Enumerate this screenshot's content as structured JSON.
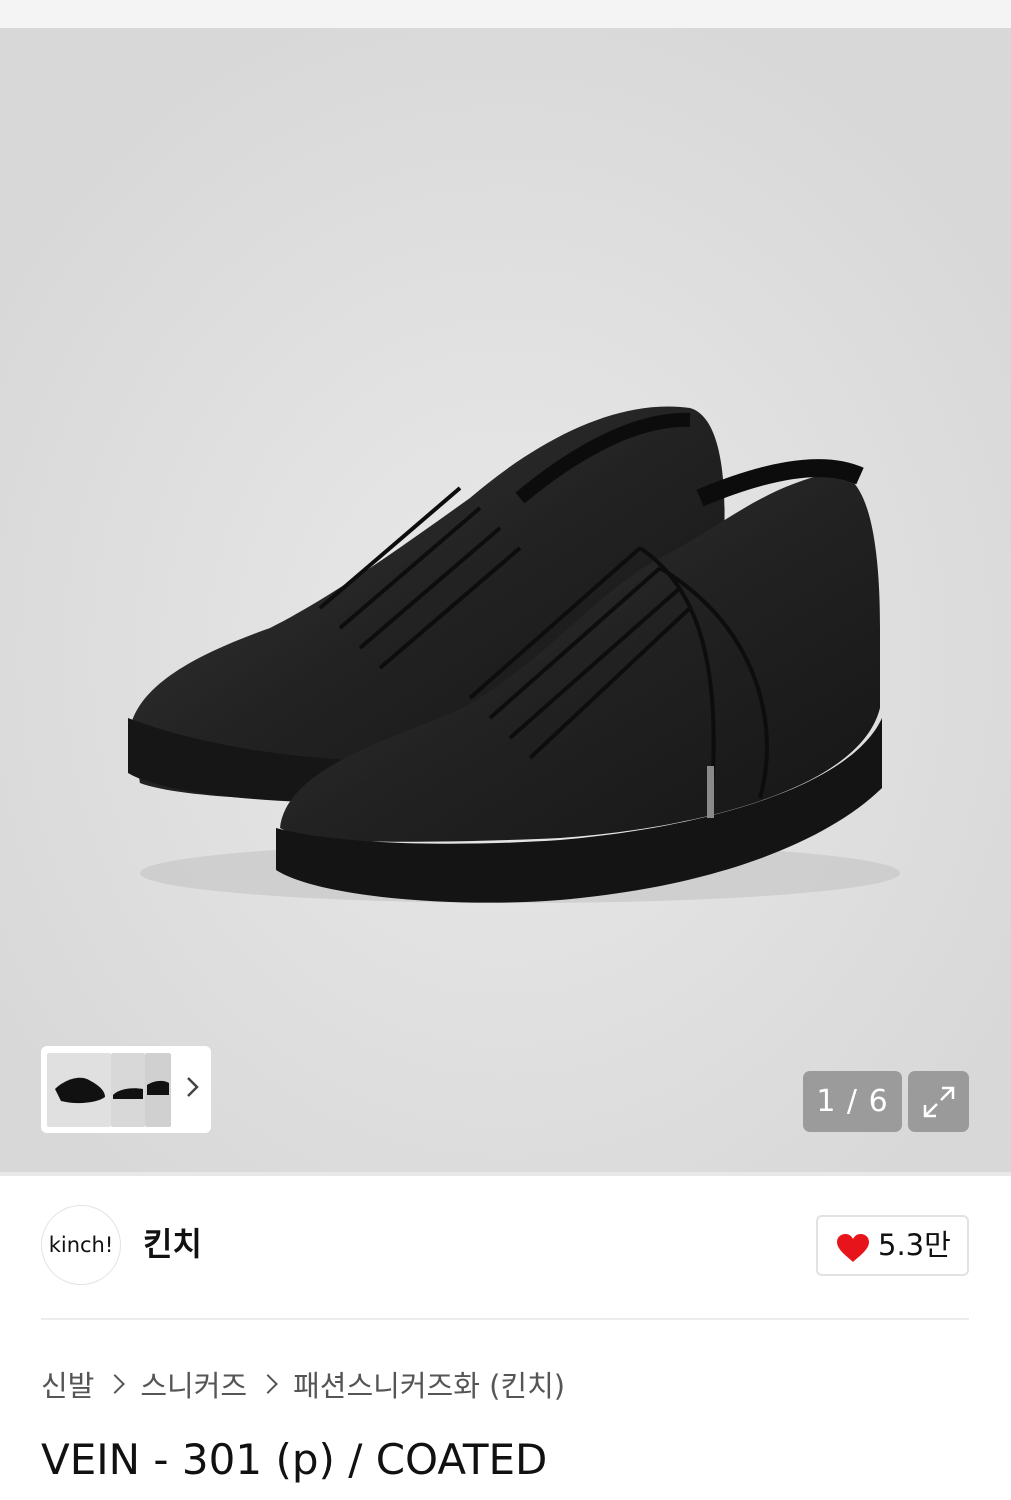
{
  "gallery": {
    "counter": "1 / 6",
    "thumbnails": [
      "sneaker-pair-thumb",
      "sneaker-side-thumb",
      "sneaker-back-thumb"
    ],
    "icons": {
      "next": "chevron-right-icon",
      "expand": "expand-icon"
    }
  },
  "brand": {
    "logo_text": "kinch!",
    "name": "킨치",
    "likes": "5.3만",
    "like_icon": "heart-icon",
    "like_color": "#e8141c"
  },
  "breadcrumb": {
    "items": [
      "신발",
      "스니커즈",
      "패션스니커즈화 (킨치)"
    ]
  },
  "product": {
    "title": "VEIN - 301 (p) / COATED"
  }
}
